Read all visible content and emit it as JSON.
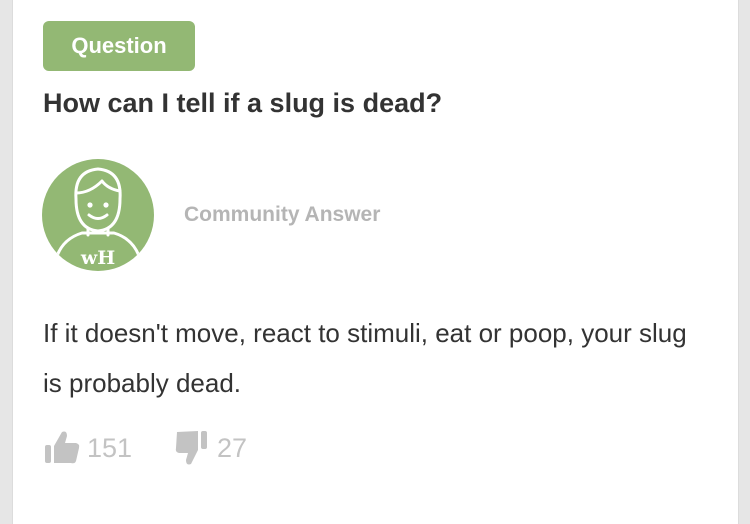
{
  "badge": {
    "label": "Question"
  },
  "question": {
    "title": "How can I tell if a slug is dead?"
  },
  "author": {
    "avatar_text": "wH",
    "label": "Community Answer"
  },
  "answer": {
    "text": "If it doesn't move, react to stimuli, eat or poop, your slug is probably dead."
  },
  "votes": {
    "helpful_count": "151",
    "not_helpful_count": "27"
  },
  "icons": {
    "thumbs_up": "thumbs-up-icon",
    "thumbs_down": "thumbs-down-icon"
  },
  "colors": {
    "accent_green": "#93b874",
    "text_dark": "#333333",
    "muted_gray": "#b5b5b5"
  }
}
